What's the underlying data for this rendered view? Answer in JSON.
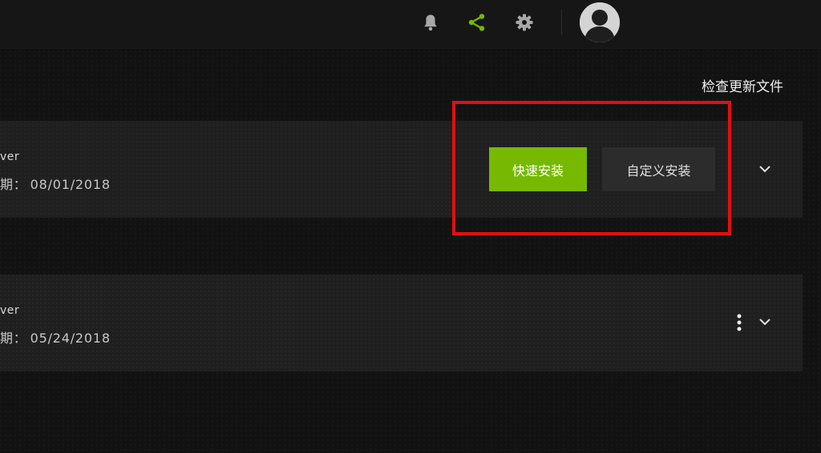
{
  "header": {
    "icons": {
      "notifications": "bell-icon",
      "share": "share-icon",
      "settings": "gear-icon",
      "account": "avatar"
    },
    "share_color": "#76b900"
  },
  "drivers": {
    "check_updates_label": "检查更新文件",
    "items": [
      {
        "name_fragment": "ver",
        "date_prefix": "期：",
        "date": "08/01/2018",
        "express_install_label": "快速安装",
        "custom_install_label": "自定义安装"
      },
      {
        "name_fragment": "ver",
        "date_prefix": "期：",
        "date": "05/24/2018"
      }
    ]
  },
  "colors": {
    "accent": "#76b900",
    "highlight": "#e10f12",
    "background": "#121212",
    "card": "#1f1f1f"
  }
}
